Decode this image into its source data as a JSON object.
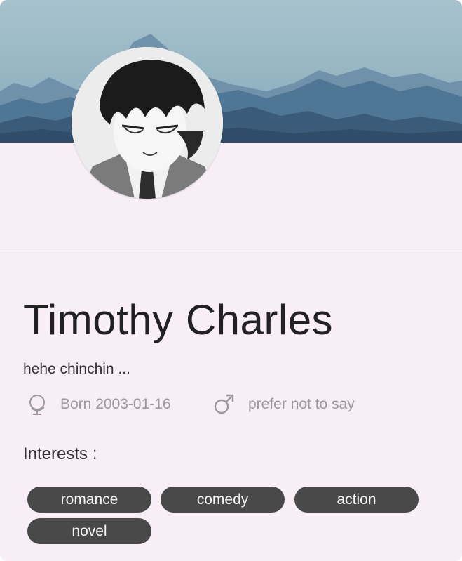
{
  "profile": {
    "name": "Timothy Charles",
    "bio": "hehe chinchin ...",
    "born": "Born 2003-01-16",
    "gender": "prefer not to say",
    "interests_label": "Interests :",
    "interests": [
      "romance",
      "comedy",
      "action",
      "novel"
    ]
  },
  "icons": {
    "born": "globe-stand-icon",
    "gender": "male-symbol-icon"
  },
  "colors": {
    "card_background": "#f8eef6",
    "tag_background": "#494949",
    "tag_text": "#f4f4f4",
    "meta_text": "#9a9a9a"
  }
}
